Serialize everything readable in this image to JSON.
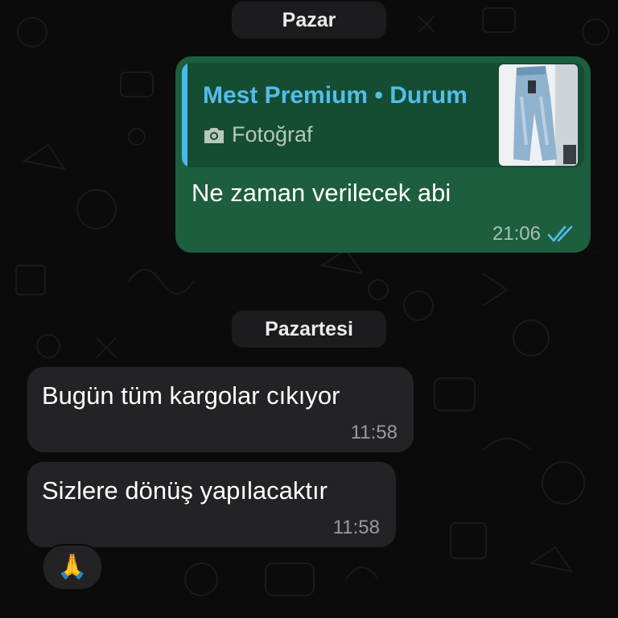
{
  "date_separators": {
    "first": "Pazar",
    "second": "Pazartesi"
  },
  "outgoing_message": {
    "quoted_reply": {
      "title": "Mest Premium • Durum",
      "media_type": "Fotoğraf",
      "media_icon": "camera-icon",
      "thumbnail": "jeans-photo"
    },
    "text": "Ne zaman verilecek abi",
    "time": "21:06",
    "status_icon": "double-check-read-icon"
  },
  "incoming_messages": [
    {
      "text": "Bugün tüm kargolar cıkıyor",
      "time": "11:58"
    },
    {
      "text": "Sizlere dönüş yapılacaktır",
      "time": "11:58"
    }
  ],
  "reaction": {
    "emoji": "🙏"
  },
  "colors": {
    "background": "#0b0b0b",
    "outgoing_bubble": "#1d5e3f",
    "incoming_bubble": "#232325",
    "accent_blue": "#53bdeb"
  }
}
